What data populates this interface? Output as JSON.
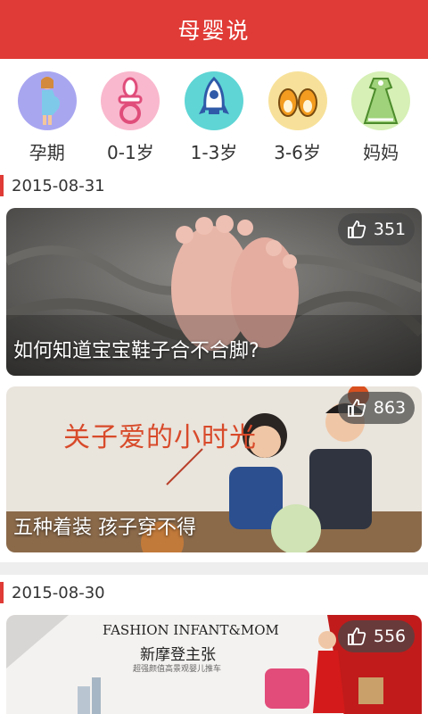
{
  "header": {
    "title": "母婴说"
  },
  "categories": [
    {
      "label": "孕期",
      "icon": "pregnant-woman-icon",
      "color": "#a9a6f0"
    },
    {
      "label": "0-1岁",
      "icon": "pacifier-icon",
      "color": "#f9b8cd"
    },
    {
      "label": "1-3岁",
      "icon": "rocket-icon",
      "color": "#5fd5d5"
    },
    {
      "label": "3-6岁",
      "icon": "baby-shoes-icon",
      "color": "#f7e19a"
    },
    {
      "label": "妈妈",
      "icon": "dress-icon",
      "color": "#d6f0b5"
    }
  ],
  "sections": [
    {
      "date": "2015-08-31",
      "cards": [
        {
          "caption": "如何知道宝宝鞋子合不合脚?",
          "likes": "351"
        },
        {
          "caption": "五种着装 孩子穿不得",
          "likes": "863",
          "art_title": "关子爱的小时光"
        }
      ]
    },
    {
      "date": "2015-08-30",
      "cards": [
        {
          "caption": "",
          "likes": "556",
          "banner_title": "FASHION INFANT&MOM",
          "banner_sub": "新摩登主张",
          "banner_small": "超强颜值高景观婴儿推车"
        }
      ]
    }
  ],
  "colors": {
    "accent": "#e03b36"
  }
}
